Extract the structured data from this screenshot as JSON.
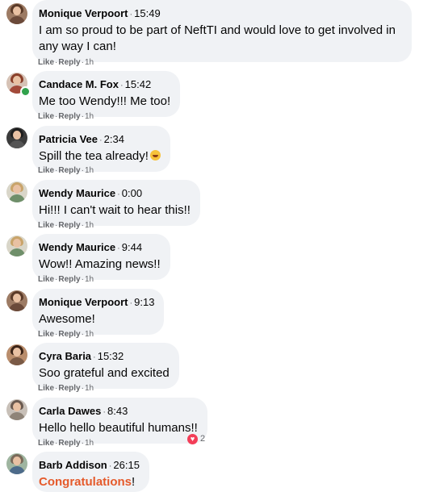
{
  "actions": {
    "like": "Like",
    "reply": "Reply",
    "age": "1h",
    "dot": "·"
  },
  "comments": [
    {
      "author": "Monique Verpoort",
      "time": "15:49",
      "text": "I am so proud to be part of NeftTI and would love to get involved in any way I can!",
      "avatar_icon": "user-avatar"
    },
    {
      "author": "Candace M. Fox",
      "time": "15:42",
      "text": "Me too Wendy!!! Me too!",
      "avatar_icon": "user-avatar",
      "online": true
    },
    {
      "author": "Patricia Vee",
      "time": "2:34",
      "text": "Spill the tea already!",
      "avatar_icon": "user-avatar",
      "emoji_icon": "laughing-emoji-icon"
    },
    {
      "author": "Wendy Maurice",
      "time": "0:00",
      "text": "Hi!!! I can't wait to hear this!!",
      "avatar_icon": "user-avatar"
    },
    {
      "author": "Wendy Maurice",
      "time": "9:44",
      "text": "Wow!! Amazing news!!",
      "avatar_icon": "user-avatar"
    },
    {
      "author": "Monique Verpoort",
      "time": "9:13",
      "text": "Awesome!",
      "avatar_icon": "user-avatar"
    },
    {
      "author": "Cyra Baria",
      "time": "15:32",
      "text": "Soo grateful and excited",
      "avatar_icon": "user-avatar"
    },
    {
      "author": "Carla Dawes",
      "time": "8:43",
      "text": "Hello hello beautiful humans!!",
      "avatar_icon": "user-avatar",
      "reaction_icon": "heart-reaction-icon",
      "reaction_count": "2"
    },
    {
      "author": "Barb Addison",
      "time": "26:15",
      "text": "Congratulations",
      "text_suffix": "!",
      "avatar_icon": "user-avatar"
    }
  ],
  "colors": {
    "bubble": "#f0f2f5",
    "secondary_text": "#65676b",
    "online": "#31a24c",
    "heart": "#f33e58",
    "highlight_text": "#e55a2b"
  }
}
